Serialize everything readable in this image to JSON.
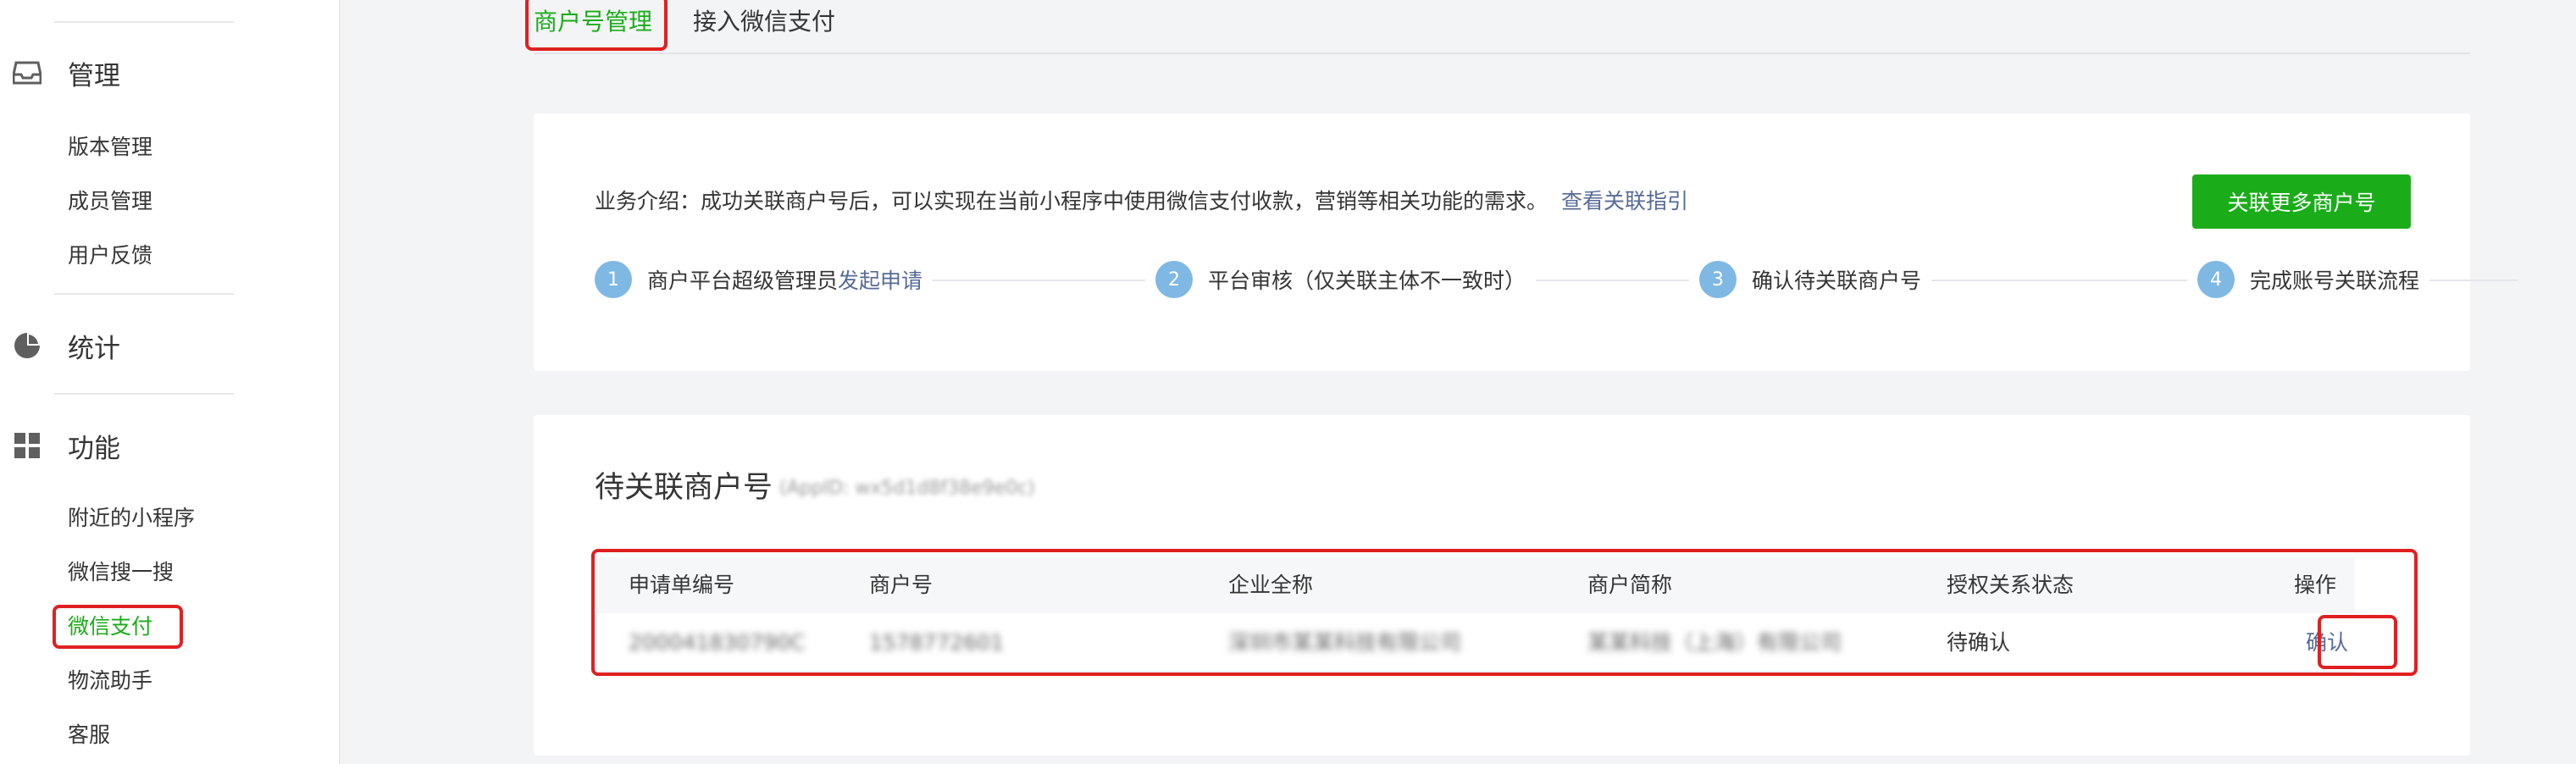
{
  "sidebar": {
    "sections": [
      {
        "label": "管理",
        "icon": "inbox-icon",
        "items": [
          "版本管理",
          "成员管理",
          "用户反馈"
        ]
      },
      {
        "label": "统计",
        "icon": "pie-chart-icon",
        "items": []
      },
      {
        "label": "功能",
        "icon": "grid-icon",
        "items": [
          "附近的小程序",
          "微信搜一搜",
          "微信支付",
          "物流助手",
          "客服"
        ]
      }
    ],
    "active_item": "微信支付"
  },
  "tabs": [
    {
      "label": "商户号管理",
      "active": true
    },
    {
      "label": "接入微信支付",
      "active": false
    }
  ],
  "intro": {
    "text": "业务介绍：成功关联商户号后，可以实现在当前小程序中使用微信支付收款，营销等相关功能的需求。",
    "link": "查看关联指引",
    "button": "关联更多商户号"
  },
  "steps": [
    {
      "num": "1",
      "text": "商户平台超级管理员",
      "link": "发起申请"
    },
    {
      "num": "2",
      "text": "平台审核（仅关联主体不一致时）",
      "link": ""
    },
    {
      "num": "3",
      "text": "确认待关联商户号",
      "link": ""
    },
    {
      "num": "4",
      "text": "完成账号关联流程",
      "link": ""
    }
  ],
  "pending": {
    "title": "待关联商户号",
    "subtitle": "(AppID: wx5d1d8f38e9e0c)",
    "columns": [
      "申请单编号",
      "商户号",
      "企业全称",
      "商户简称",
      "授权关系状态",
      "操作"
    ],
    "rows": [
      {
        "id": "200041830790C",
        "mch_id": "1578772601",
        "company": "深圳市某某科技有限公司",
        "short_name": "某某科技（上海）有限公司",
        "status": "待确认",
        "action": "确认"
      }
    ]
  },
  "colors": {
    "accent": "#1aad19",
    "link": "#576b95",
    "highlight": "#e02020",
    "step": "#7fb8e3"
  }
}
